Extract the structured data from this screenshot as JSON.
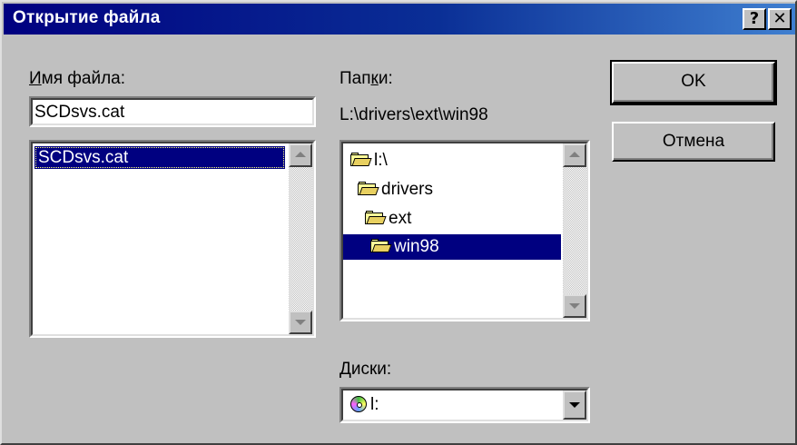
{
  "window": {
    "title": "Открытие файла",
    "help_button": "?",
    "close_button": "✕"
  },
  "file_name": {
    "label_accel": "И",
    "label_rest": "мя файла:",
    "value": "SCDsvs.cat",
    "list": [
      "SCDsvs.cat"
    ]
  },
  "folders": {
    "label_pre": "Пап",
    "label_accel": "к",
    "label_post": "и:",
    "current_path": "L:\\drivers\\ext\\win98",
    "tree": [
      "l:\\",
      "drivers",
      "ext",
      "win98"
    ],
    "selected": "win98"
  },
  "drives": {
    "label_accel": "Д",
    "label_rest": "иски:",
    "selected": "l:"
  },
  "buttons": {
    "ok": "OK",
    "cancel": "Отмена"
  },
  "icons": {
    "folder": "folder-open-icon",
    "drive": "cd-drive-icon"
  },
  "colors": {
    "title_bar": "#000080",
    "selection": "#000080",
    "face": "#c0c0c0"
  }
}
